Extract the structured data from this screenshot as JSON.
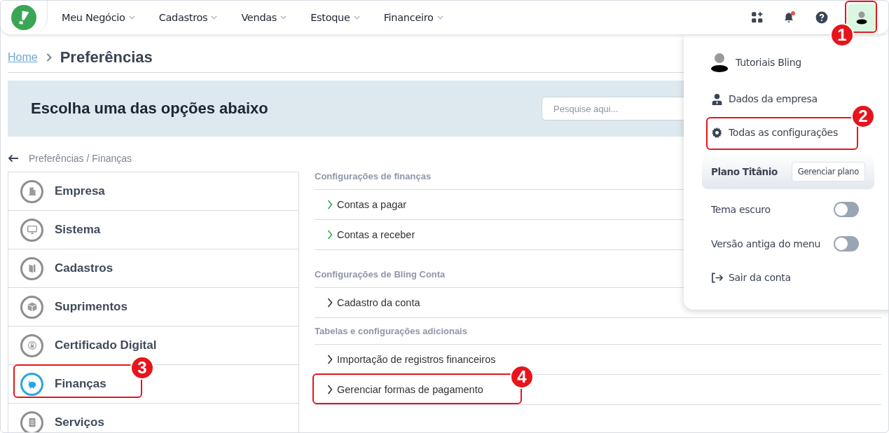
{
  "nav": {
    "items": [
      "Meu Negócio",
      "Cadastros",
      "Vendas",
      "Estoque",
      "Financeiro"
    ],
    "notification": true,
    "user_callout": "1"
  },
  "breadcrumb": {
    "home": "Home",
    "current": "Preferências"
  },
  "banner": {
    "title": "Escolha uma das opções abaixo",
    "search": {
      "placeholder": "Pesquise aqui..."
    }
  },
  "path": "Preferências / Finanças",
  "sidebar": {
    "items": [
      {
        "label": "Empresa",
        "selected": false
      },
      {
        "label": "Sistema",
        "selected": false
      },
      {
        "label": "Cadastros",
        "selected": false
      },
      {
        "label": "Suprimentos",
        "selected": false
      },
      {
        "label": "Certificado Digital",
        "selected": false
      },
      {
        "label": "Finanças",
        "selected": true,
        "callout": "3"
      },
      {
        "label": "Serviços",
        "selected": false
      }
    ]
  },
  "sections": [
    {
      "title": "Configurações de finanças",
      "items": [
        {
          "label": "Contas a pagar",
          "accent": true
        },
        {
          "label": "Contas a receber",
          "accent": true
        }
      ]
    },
    {
      "title": "Configurações de Bling Conta",
      "items": [
        {
          "label": "Cadastro da conta",
          "accent": false
        }
      ]
    },
    {
      "title": "Tabelas e configurações adicionais",
      "items": [
        {
          "label": "Importação de registros financeiros",
          "accent": false
        },
        {
          "label": "Gerenciar formas de pagamento",
          "accent": false,
          "callout": "4"
        }
      ]
    }
  ],
  "user_menu": {
    "user": "Tutoriais Bling",
    "items": [
      {
        "label": "Dados da empresa"
      },
      {
        "label": "Todas as configurações",
        "callout": "2"
      }
    ],
    "plan": {
      "name": "Plano Titânio",
      "button": "Gerenciar plano"
    },
    "toggles": [
      {
        "label": "Tema escuro",
        "on": false
      },
      {
        "label": "Versão antiga do menu",
        "on": false
      }
    ],
    "logout": "Sair da conta"
  }
}
